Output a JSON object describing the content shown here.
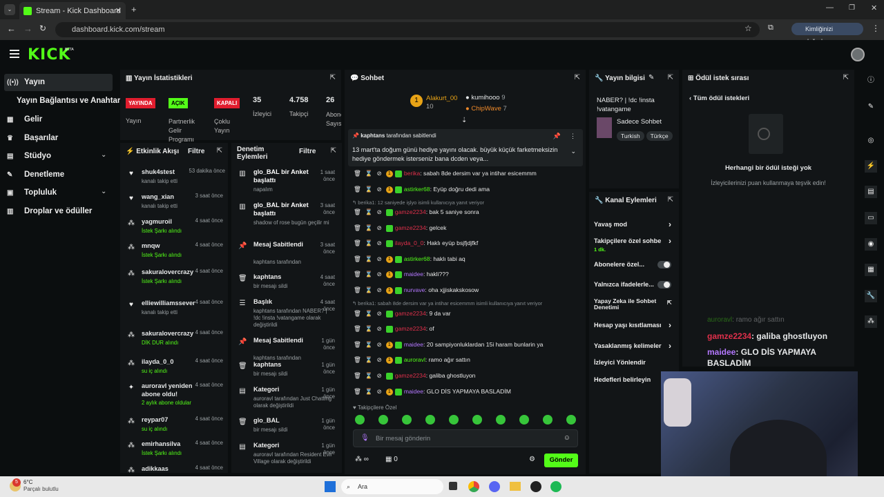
{
  "browser": {
    "tab_title": "Stream - Kick Dashboard",
    "url": "dashboard.kick.com/stream",
    "profile_label": "Kimliğinizi doğrulayın"
  },
  "brand": {
    "logo": "KICK",
    "beta": "BETA"
  },
  "sidebar": {
    "items": [
      {
        "label": "Yayın",
        "icon": "broadcast-icon"
      },
      {
        "label": "Yayın Bağlantısı ve Anahtarı",
        "icon": ""
      },
      {
        "label": "Gelir",
        "icon": "revenue-icon"
      },
      {
        "label": "Başarılar",
        "icon": "trophy-icon"
      },
      {
        "label": "Stüdyo",
        "icon": "studio-icon"
      },
      {
        "label": "Denetleme",
        "icon": "moderation-icon"
      },
      {
        "label": "Topluluk",
        "icon": "community-icon"
      },
      {
        "label": "Droplar ve ödüller",
        "icon": "drops-icon"
      }
    ]
  },
  "stats": {
    "title": "Yayın İstatistikleri",
    "items": [
      {
        "badge": "YAYINDA",
        "label": "Yayın",
        "color": "#e11d2e"
      },
      {
        "badge": "AÇIK",
        "label": "Partnerlik Gelir Programı",
        "color": "#53fc18"
      },
      {
        "badge": "KAPALI",
        "label": "Çoklu Yayın",
        "color": "#e11d2e"
      },
      {
        "value": "35",
        "label": "İzleyici"
      },
      {
        "value": "4.758",
        "label": "Takipçi"
      },
      {
        "value": "26",
        "label": "Abone Sayısı"
      }
    ]
  },
  "activity": {
    "title": "Etkinlik Akışı",
    "filter": "Filtre",
    "items": [
      {
        "name": "shuk4stest",
        "time": "53 dakika önce",
        "sub": "kanalı takip etti",
        "icon": "heart-icon"
      },
      {
        "name": "wang_xian",
        "time": "3 saat önce",
        "sub": "kanalı takip etti",
        "icon": "heart-icon"
      },
      {
        "name": "yagmuroil",
        "time": "4 saat önce",
        "sub": "İstek Şarkı alındı",
        "icon": "points-icon"
      },
      {
        "name": "mnqw",
        "time": "4 saat önce",
        "sub": "İstek Şarkı alındı",
        "icon": "points-icon"
      },
      {
        "name": "sakuralovercrazy",
        "time": "4 saat önce",
        "sub": "İstek Şarkı alındı",
        "icon": "points-icon"
      },
      {
        "name": "elliewilliamssever",
        "time": "4 saat önce",
        "sub": "kanalı takip etti",
        "icon": "heart-icon"
      },
      {
        "name": "sakuralovercrazy",
        "time": "4 saat önce",
        "sub": "DİK DUR alındı",
        "icon": "points-icon"
      },
      {
        "name": "ilayda_0_0",
        "time": "4 saat önce",
        "sub": "su iç alındı",
        "icon": "points-icon"
      },
      {
        "name": "auroravl yeniden abone oldu!",
        "time": "4 saat önce",
        "sub": "2 aylık abone oldular",
        "icon": "star-icon"
      },
      {
        "name": "reypar07",
        "time": "4 saat önce",
        "sub": "su iç alındı",
        "icon": "points-icon"
      },
      {
        "name": "emirhansilva",
        "time": "4 saat önce",
        "sub": "İstek Şarkı alındı",
        "icon": "points-icon"
      },
      {
        "name": "adikkaas",
        "time": "4 saat önce",
        "sub": "",
        "icon": "points-icon"
      }
    ]
  },
  "mod": {
    "title": "Denetim Eylemleri",
    "filter": "Filtre",
    "items": [
      {
        "title": "glo_BAL bir Anket başlattı",
        "time": "1 saat önce",
        "sub": "napalım",
        "icon": "poll-icon"
      },
      {
        "title": "glo_BAL bir Anket başlattı",
        "time": "3 saat önce",
        "sub": "shadow of rose bugün geçilir mi",
        "icon": "poll-icon"
      },
      {
        "title": "Mesaj Sabitlendi",
        "time": "3 saat önce",
        "sub": "kaphtans tarafından",
        "icon": "pin-icon"
      },
      {
        "title": "kaphtans",
        "time": "4 saat önce",
        "sub": "bir mesajı sildi",
        "icon": "trash-icon"
      },
      {
        "title": "Başlık",
        "time": "4 saat önce",
        "sub": "kaphtans tarafından NABER? | !dc !insta !vatangame olarak değiştirildi",
        "icon": "title-icon"
      },
      {
        "title": "Mesaj Sabitlendi",
        "time": "1 gün önce",
        "sub": "kaphtans tarafından",
        "icon": "pin-icon"
      },
      {
        "title": "kaphtans",
        "time": "1 gün önce",
        "sub": "bir mesajı sildi",
        "icon": "trash-icon"
      },
      {
        "title": "Kategori",
        "time": "1 gün önce",
        "sub": "auroravl tarafından Just Chatting olarak değiştirildi",
        "icon": "category-icon"
      },
      {
        "title": "glo_BAL",
        "time": "1 gün önce",
        "sub": "bir mesajı sildi",
        "icon": "trash-icon"
      },
      {
        "title": "Kategori",
        "time": "1 gün önce",
        "sub": "auroravl tarafından Resident Evil Village olarak değiştirildi",
        "icon": "category-icon"
      }
    ]
  },
  "chat": {
    "title": "Sohbet",
    "leaders": [
      {
        "name": "Alakurt_00",
        "value": "10"
      },
      {
        "name": "kumihooo",
        "value": "9"
      },
      {
        "name": "ChipWave",
        "value": "7"
      }
    ],
    "pinned": {
      "by": "kaphtans",
      "suffix": "tarafından sabitlendi",
      "text": "13 mart'ta doğum günü hediye yayını olacak. büyük küçük farketmeksizin hediye göndermek isterseniz bana dcden veya..."
    },
    "messages": [
      {
        "user": "berika",
        "color": "#e0304b",
        "text": "sabah 8de dersim var ya intihar esicemmm",
        "coin": true
      },
      {
        "user": "astirker68",
        "color": "#53fc18",
        "text": "Eyüp doğru dedi ama",
        "coin": true
      },
      {
        "reply": "berika1: 12 saniyede işlyo isimli kullanıcıya yanıt veriyor"
      },
      {
        "user": "gamze2234",
        "color": "#e0304b",
        "text": "bak 5 saniye sonra"
      },
      {
        "user": "gamze2234",
        "color": "#e0304b",
        "text": "gelcek"
      },
      {
        "user": "ilayda_0_0",
        "color": "#e0304b",
        "text": "Haklı eyüp bsjfjdjfkf"
      },
      {
        "user": "astirker68",
        "color": "#53fc18",
        "text": "haklı tabi aq",
        "coin": true
      },
      {
        "user": "maidee",
        "color": "#b478ff",
        "text": "hakli???",
        "coin": true
      },
      {
        "user": "nurvave",
        "color": "#b478ff",
        "text": "oha xjjiskakskosow",
        "coin": true
      },
      {
        "reply": "berika1: sabah 8de dersim var ya intihar esicemmm isimli kullanıcıya yanıt veriyor"
      },
      {
        "user": "gamze2234",
        "color": "#e0304b",
        "text": "9 da var"
      },
      {
        "user": "gamze2234",
        "color": "#e0304b",
        "text": "of"
      },
      {
        "user": "maidee",
        "color": "#b478ff",
        "text": "20 sampiyonluklardan 15i haram bunlarin ya",
        "coin": true
      },
      {
        "user": "auroravl",
        "color": "#53fc18",
        "text": "ramo ağır sattın",
        "coin": true
      },
      {
        "user": "gamze2234",
        "color": "#e0304b",
        "text": "galiba ghostluyon"
      },
      {
        "user": "maidee",
        "color": "#b478ff",
        "text": "GLO DİS YAPMAYA BASLADİM",
        "coin": true
      }
    ],
    "followers_label": "Takipçilere Özel",
    "input_placeholder": "Bir mesaj gönderin",
    "points": "∞",
    "store_count": "0",
    "send": "Gönder"
  },
  "info": {
    "title": "Yayın bilgisi",
    "stream_title": "NABER? | !dc !insta !vatangame",
    "category": "Sadece Sohbet",
    "tags": [
      "Turkish",
      "Türkçe"
    ]
  },
  "channel": {
    "title": "Kanal Eylemleri",
    "items": [
      {
        "label": "Yavaş mod",
        "type": "arrow"
      },
      {
        "label": "Takipçilere özel sohbe",
        "sub": "1 dk.",
        "type": "arrow"
      },
      {
        "label": "Abonelere özel...",
        "type": "toggle"
      },
      {
        "label": "Yalnızca ifadelerle...",
        "type": "toggle"
      },
      {
        "label": "Yapay Zeka ile Sohbet Denetimi",
        "type": "external"
      },
      {
        "label": "Hesap yaşı kısıtlaması",
        "type": "arrow"
      },
      {
        "label": "Yasaklanmış kelimeler",
        "type": "arrow"
      },
      {
        "label": "İzleyici Yönlendir",
        "type": "none"
      },
      {
        "label": "Hedefleri belirleyin",
        "type": "none"
      }
    ]
  },
  "rewards": {
    "title": "Ödül istek sırası",
    "back": "Tüm ödül istekleri",
    "empty_title": "Herhangi bir ödül isteği yok",
    "empty_sub": "İzleyicilerinizi puan kullanmaya teşvik edin!"
  },
  "overlay": {
    "lines": [
      {
        "user": "auroravl",
        "color": "#53fc18",
        "text": "ramo ağır sattın"
      },
      {
        "user": "gamze2234",
        "color": "#e0304b",
        "text": "galiba ghostluyon"
      },
      {
        "user": "maidee",
        "color": "#b478ff",
        "text": "GLO DİS YAPMAYA BASLADİM"
      }
    ]
  },
  "taskbar": {
    "temp": "6°C",
    "weather": "Parçalı bulutlu",
    "search": "Ara",
    "notif": "5"
  }
}
